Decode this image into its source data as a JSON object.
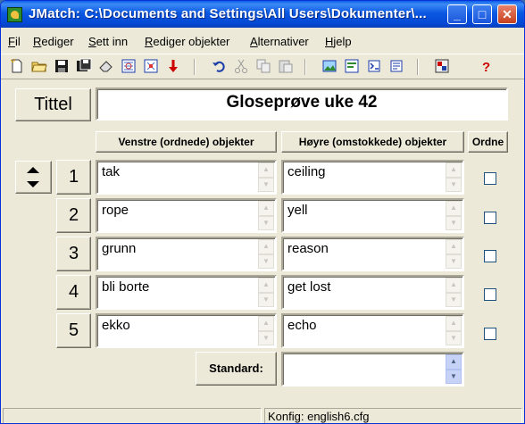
{
  "window": {
    "title": "JMatch: C:\\Documents and Settings\\All Users\\Dokumenter\\...",
    "min_glyph": "_",
    "max_glyph": "□",
    "close_glyph": "✕"
  },
  "menu": [
    {
      "u": "F",
      "rest": "il"
    },
    {
      "u": "R",
      "rest": "ediger"
    },
    {
      "u": "S",
      "rest": "ett inn"
    },
    {
      "u": "R",
      "rest": "ediger objekter"
    },
    {
      "u": "A",
      "rest": "lternativer"
    },
    {
      "u": "H",
      "rest": "jelp"
    }
  ],
  "toolbar_icons": [
    "new-file-icon",
    "open-folder-icon",
    "save-icon",
    "save-as-icon",
    "eraser-icon",
    "create-web-page-icon",
    "create-drag-drop-icon",
    "export-arrow-icon",
    "undo-icon",
    "cut-icon",
    "copy-icon",
    "paste-icon",
    "add-picture-icon",
    "add-link-icon",
    "options-icon",
    "feedback-icon",
    "config-icon",
    "help-icon"
  ],
  "title_section": {
    "button_label": "Tittel",
    "title_value": "Gloseprøve uke 42"
  },
  "columns": {
    "left_header": "Venstre (ordnede) objekter",
    "right_header": "Høyre (omstokkede) objekter",
    "fixed_header": "Ordne"
  },
  "rows": [
    {
      "num": "1",
      "left": "tak",
      "right": "ceiling",
      "fixed": false
    },
    {
      "num": "2",
      "left": "rope",
      "right": "yell",
      "fixed": false
    },
    {
      "num": "3",
      "left": "grunn",
      "right": "reason",
      "fixed": false
    },
    {
      "num": "4",
      "left": "bli borte",
      "right": "get lost",
      "fixed": false
    },
    {
      "num": "5",
      "left": "ekko",
      "right": "echo",
      "fixed": false
    }
  ],
  "standard": {
    "label": "Standard:",
    "value": ""
  },
  "status": {
    "config": "Konfig: english6.cfg"
  },
  "colors": {
    "titlebar": "#0a58e2",
    "close_button": "#c7401e",
    "face": "#ece9d8"
  }
}
